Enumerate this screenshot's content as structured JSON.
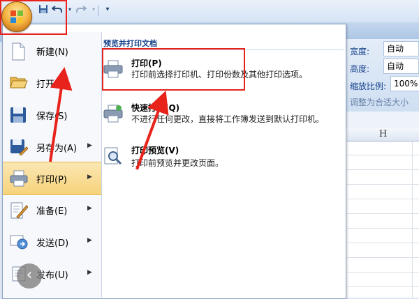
{
  "qat": {
    "quick_access_symbol": "▾"
  },
  "ribbon": {
    "width_label": "宽度:",
    "width_value": "自动",
    "height_label": "高度:",
    "height_value": "自动",
    "scale_label": "缩放比例:",
    "scale_value": "100%",
    "fit_label": "调整为合适大小"
  },
  "sheet": {
    "column_h": "H"
  },
  "menu": {
    "items": [
      {
        "label": "新建(N)",
        "icon": "new-document-icon",
        "has_submenu": false
      },
      {
        "label": "打开(O)",
        "icon": "open-folder-icon",
        "has_submenu": false
      },
      {
        "label": "保存(S)",
        "icon": "save-icon",
        "has_submenu": false
      },
      {
        "label": "另存为(A)",
        "icon": "save-as-icon",
        "has_submenu": true
      },
      {
        "label": "打印(P)",
        "icon": "print-icon",
        "has_submenu": true,
        "selected": true
      },
      {
        "label": "准备(E)",
        "icon": "prepare-icon",
        "has_submenu": true
      },
      {
        "label": "发送(D)",
        "icon": "send-icon",
        "has_submenu": true
      },
      {
        "label": "发布(U)",
        "icon": "publish-icon",
        "has_submenu": true
      }
    ],
    "submenu_header": "预览并打印文档",
    "submenu": [
      {
        "title": "打印(P)",
        "desc": "打印前选择打印机、打印份数及其他打印选项。",
        "icon": "printer-icon"
      },
      {
        "title": "快速打印(Q)",
        "desc": "不进行任何更改，直接将工作簿发送到默认打印机。",
        "icon": "quick-print-icon"
      },
      {
        "title": "打印预览(V)",
        "desc": "打印前预览并更改页面。",
        "icon": "print-preview-icon"
      }
    ]
  },
  "colors": {
    "annotation_red": "#e8231c",
    "selection": "#f6d37b"
  }
}
